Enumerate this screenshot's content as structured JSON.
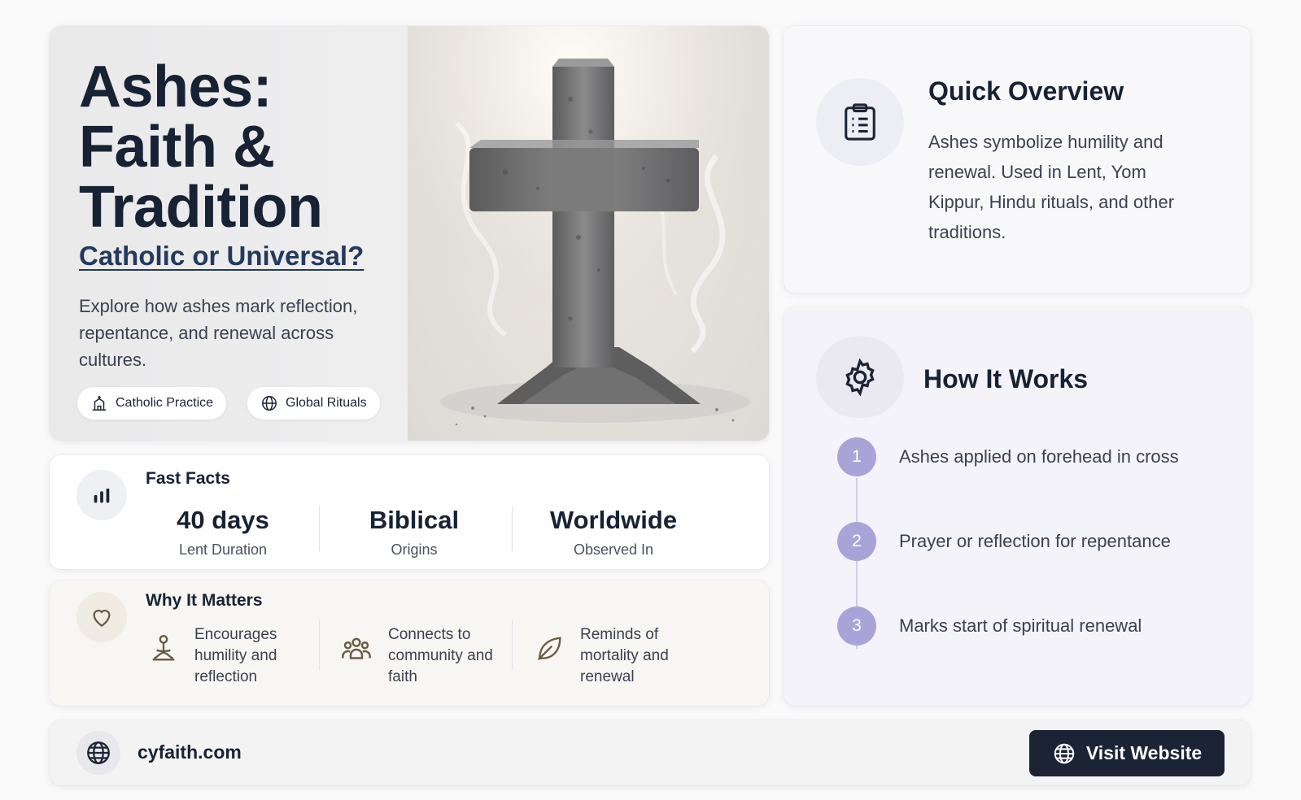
{
  "hero": {
    "title_lines": [
      "Ashes:",
      "Faith &",
      "Tradition"
    ],
    "subtitle": "Catholic or Universal?",
    "description": "Explore how ashes mark reflection, repentance, and renewal across cultures.",
    "pills": [
      {
        "label": "Catholic Practice",
        "icon": "church-icon"
      },
      {
        "label": "Global Rituals",
        "icon": "globe-icon"
      }
    ],
    "image": "ash-cross-illustration"
  },
  "fast_facts": {
    "label": "Fast Facts",
    "icon": "bar-chart-icon",
    "items": [
      {
        "value": "40 days",
        "label": "Lent Duration"
      },
      {
        "value": "Biblical",
        "label": "Origins"
      },
      {
        "value": "Worldwide",
        "label": "Observed In"
      }
    ]
  },
  "why_it_matters": {
    "label": "Why It Matters",
    "icon": "heart-icon",
    "items": [
      {
        "text": "Encourages humility and reflection",
        "icon": "meditating-person-icon"
      },
      {
        "text": "Connects to community and faith",
        "icon": "people-group-icon"
      },
      {
        "text": "Reminds of mortality and renewal",
        "icon": "leaf-icon"
      }
    ]
  },
  "overview": {
    "title": "Quick Overview",
    "icon": "clipboard-icon",
    "text": "Ashes symbolize humility and renewal. Used in Lent, Yom Kippur, Hindu rituals, and other traditions."
  },
  "how_it_works": {
    "title": "How It Works",
    "icon": "gear-icon",
    "steps": [
      {
        "num": "1",
        "text": "Ashes applied on forehead in cross"
      },
      {
        "num": "2",
        "text": "Prayer or reflection for repentance"
      },
      {
        "num": "3",
        "text": "Marks start of spiritual renewal"
      }
    ]
  },
  "footer": {
    "domain": "cyfaith.com",
    "button_label": "Visit Website",
    "icon": "globe-icon"
  },
  "colors": {
    "primary_dark": "#1a2434",
    "step_accent": "#a9a4d8",
    "why_bg": "#f7f6f2",
    "how_bg": "#f4f3f9"
  }
}
